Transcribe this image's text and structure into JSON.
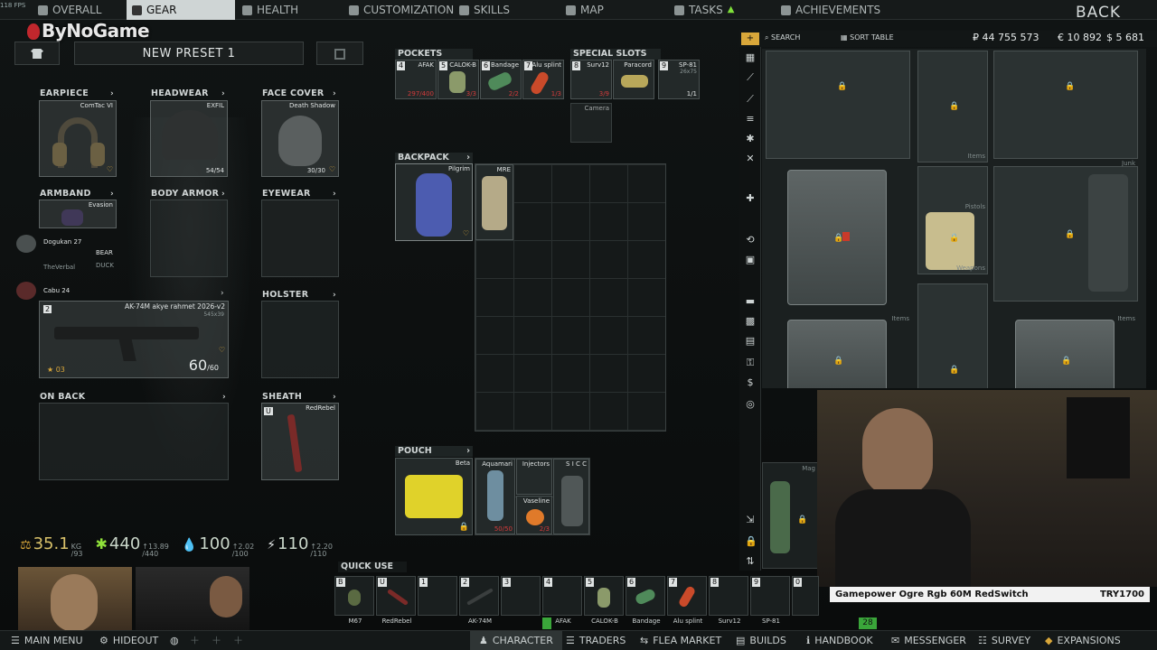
{
  "fps": "118 FPS",
  "top_nav": {
    "tabs": [
      {
        "label": "OVERALL",
        "active": false
      },
      {
        "label": "GEAR",
        "active": true
      },
      {
        "label": "HEALTH",
        "active": false
      },
      {
        "label": "CUSTOMIZATION",
        "active": false
      },
      {
        "label": "SKILLS",
        "active": false
      },
      {
        "label": "MAP",
        "active": false
      },
      {
        "label": "TASKS",
        "active": false
      },
      {
        "label": "ACHIEVEMENTS",
        "active": false
      }
    ],
    "back_label": "BACK"
  },
  "watermark": "ByNoGame",
  "preset": {
    "name": "NEW PRESET 1"
  },
  "slots": {
    "earpiece": {
      "label": "EARPIECE",
      "item": "ComTac VI"
    },
    "headwear": {
      "label": "HEADWEAR",
      "item": "EXFIL",
      "value": "54/54"
    },
    "face_cover": {
      "label": "FACE COVER",
      "item": "Death Shadow",
      "value": "30/30"
    },
    "armband": {
      "label": "ARMBAND",
      "item": "Evasion"
    },
    "body_armor": {
      "label": "BODY ARMOR"
    },
    "eyewear": {
      "label": "EYEWEAR"
    },
    "primary": {
      "num": "2",
      "item": "AK-74M akye rahmet 2026-v2",
      "caliber": "545x39",
      "ammo": "60",
      "ammo_max": "/60",
      "level": "03"
    },
    "holster": {
      "label": "HOLSTER"
    },
    "on_back": {
      "label": "ON BACK"
    },
    "sheath": {
      "label": "SHEATH",
      "item": "RedRebel"
    }
  },
  "squad": [
    {
      "name": "Dogukan",
      "level": "27",
      "faction": "BEAR"
    },
    {
      "name": "TheVerbal",
      "faction": "DUCK"
    },
    {
      "name": "Cabu",
      "level": "24"
    }
  ],
  "stats": {
    "weight": "35.1",
    "weight_unit": "KG",
    "weight_max": "/93",
    "energy": "440",
    "energy_max": "/440",
    "energy_rate": "↑13.89",
    "hydration": "100",
    "hydration_max": "/100",
    "hydration_rate": "↑2.02",
    "health": "110",
    "health_max": "/110",
    "health_rate": "↑2.20"
  },
  "pockets": {
    "label": "POCKETS",
    "items": [
      {
        "num": "4",
        "name": "AFAK",
        "value": "297/400",
        "value_color": "#d23b3b"
      },
      {
        "num": "5",
        "name": "CALOK-B",
        "value": "3/3",
        "value_color": "#d23b3b"
      },
      {
        "num": "6",
        "name": "Bandage",
        "value": "2/2",
        "value_color": "#d23b3b"
      },
      {
        "num": "7",
        "name": "Alu splint",
        "value": "1/3",
        "value_color": "#d23b3b"
      }
    ]
  },
  "special_slots": {
    "label": "SPECIAL SLOTS",
    "items": [
      {
        "num": "8",
        "name": "Surv12",
        "value": "3/9"
      },
      {
        "num": "",
        "name": "Paracord",
        "value": ""
      },
      {
        "num": "9",
        "name": "SP-81",
        "sub": "26x75",
        "value": "1/1"
      }
    ],
    "camera": "Camera"
  },
  "backpack": {
    "label": "BACKPACK",
    "item": "Pilgrim",
    "content": "MRE"
  },
  "pouch": {
    "label": "POUCH",
    "item": "Beta",
    "contents": [
      {
        "name": "Aquamari",
        "value": "50/50"
      },
      {
        "name": "Injectors"
      },
      {
        "name": "Vaseline",
        "value": "2/3"
      },
      {
        "name": "S I C C"
      }
    ]
  },
  "quick_use": {
    "label": "QUICK USE",
    "slots": [
      {
        "num": "B",
        "label": "M67"
      },
      {
        "num": "U",
        "label": "RedRebel"
      },
      {
        "num": "1",
        "label": ""
      },
      {
        "num": "2",
        "label": "AK-74M"
      },
      {
        "num": "3",
        "label": ""
      },
      {
        "num": "4",
        "label": "AFAK"
      },
      {
        "num": "5",
        "label": "CALOK-B"
      },
      {
        "num": "6",
        "label": "Bandage"
      },
      {
        "num": "7",
        "label": "Alu splint"
      },
      {
        "num": "8",
        "label": "Surv12"
      },
      {
        "num": "9",
        "label": "SP-81"
      },
      {
        "num": "0",
        "label": ""
      }
    ]
  },
  "stash": {
    "search_label": "SEARCH",
    "sort_label": "SORT TABLE",
    "currency": [
      {
        "symbol": "₽",
        "amount": "44 755 573"
      },
      {
        "symbol": "€",
        "amount": "10 892"
      },
      {
        "symbol": "$",
        "amount": "5 681"
      }
    ],
    "labels": [
      "Items",
      "Junk",
      "Pistols",
      "Weapons",
      "Items",
      "Items",
      "Mag"
    ]
  },
  "promo": {
    "left": "Gamepower Ogre Rgb 60M RedSwitch",
    "right": "TRY1700"
  },
  "badge_28": "28",
  "bottom_bar": {
    "left": [
      {
        "label": "MAIN MENU"
      },
      {
        "label": "HIDEOUT"
      }
    ],
    "center": [
      {
        "label": "CHARACTER",
        "active": true
      },
      {
        "label": "TRADERS"
      },
      {
        "label": "FLEA MARKET"
      },
      {
        "label": "BUILDS"
      },
      {
        "label": "HANDBOOK"
      },
      {
        "label": "MESSENGER"
      },
      {
        "label": "SURVEY"
      },
      {
        "label": "EXPANSIONS"
      }
    ]
  },
  "colors": {
    "accent": "#cfd5d5",
    "warn": "#d23b3b",
    "gold": "#d9a73a",
    "green": "#7fe03a"
  }
}
